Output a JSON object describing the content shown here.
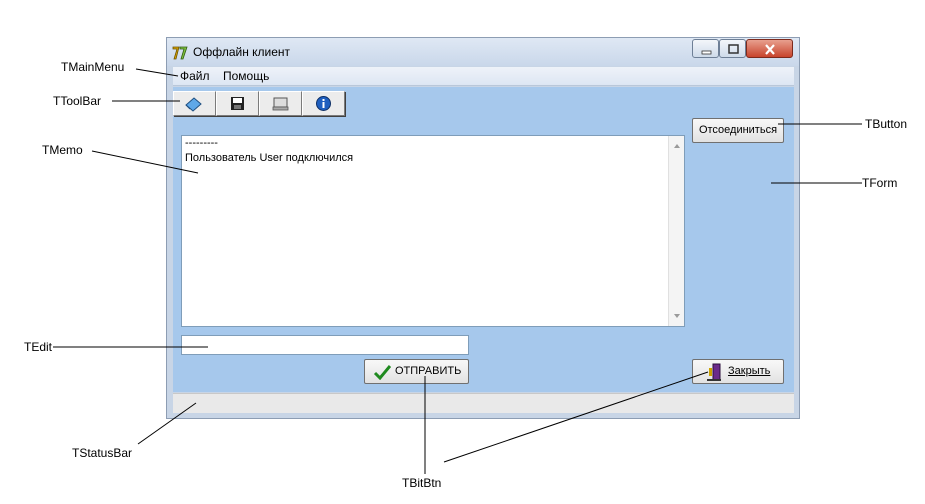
{
  "window": {
    "title": "Оффлайн клиент",
    "menu": [
      "Файл",
      "Помощь"
    ]
  },
  "memo": {
    "lines": [
      "---------",
      "Пользователь User подключился"
    ]
  },
  "edit": {
    "value": ""
  },
  "buttons": {
    "disconnect": "Отсоединиться",
    "send": "ОТПРАВИТЬ",
    "close": "Закрыть"
  },
  "annotations": {
    "main_menu": "TMainMenu",
    "toolbar": "TToolBar",
    "memo": "TMemo",
    "edit": "TEdit",
    "status_bar": "TStatusBar",
    "button": "TButton",
    "form": "TForm",
    "bitbtn": "TBitBtn"
  },
  "toolbar_icons": [
    "eraser-icon",
    "save-icon",
    "monitor-icon",
    "info-icon"
  ],
  "colors": {
    "form_background": "#a6c8ec",
    "close_button": "#c8442c"
  }
}
